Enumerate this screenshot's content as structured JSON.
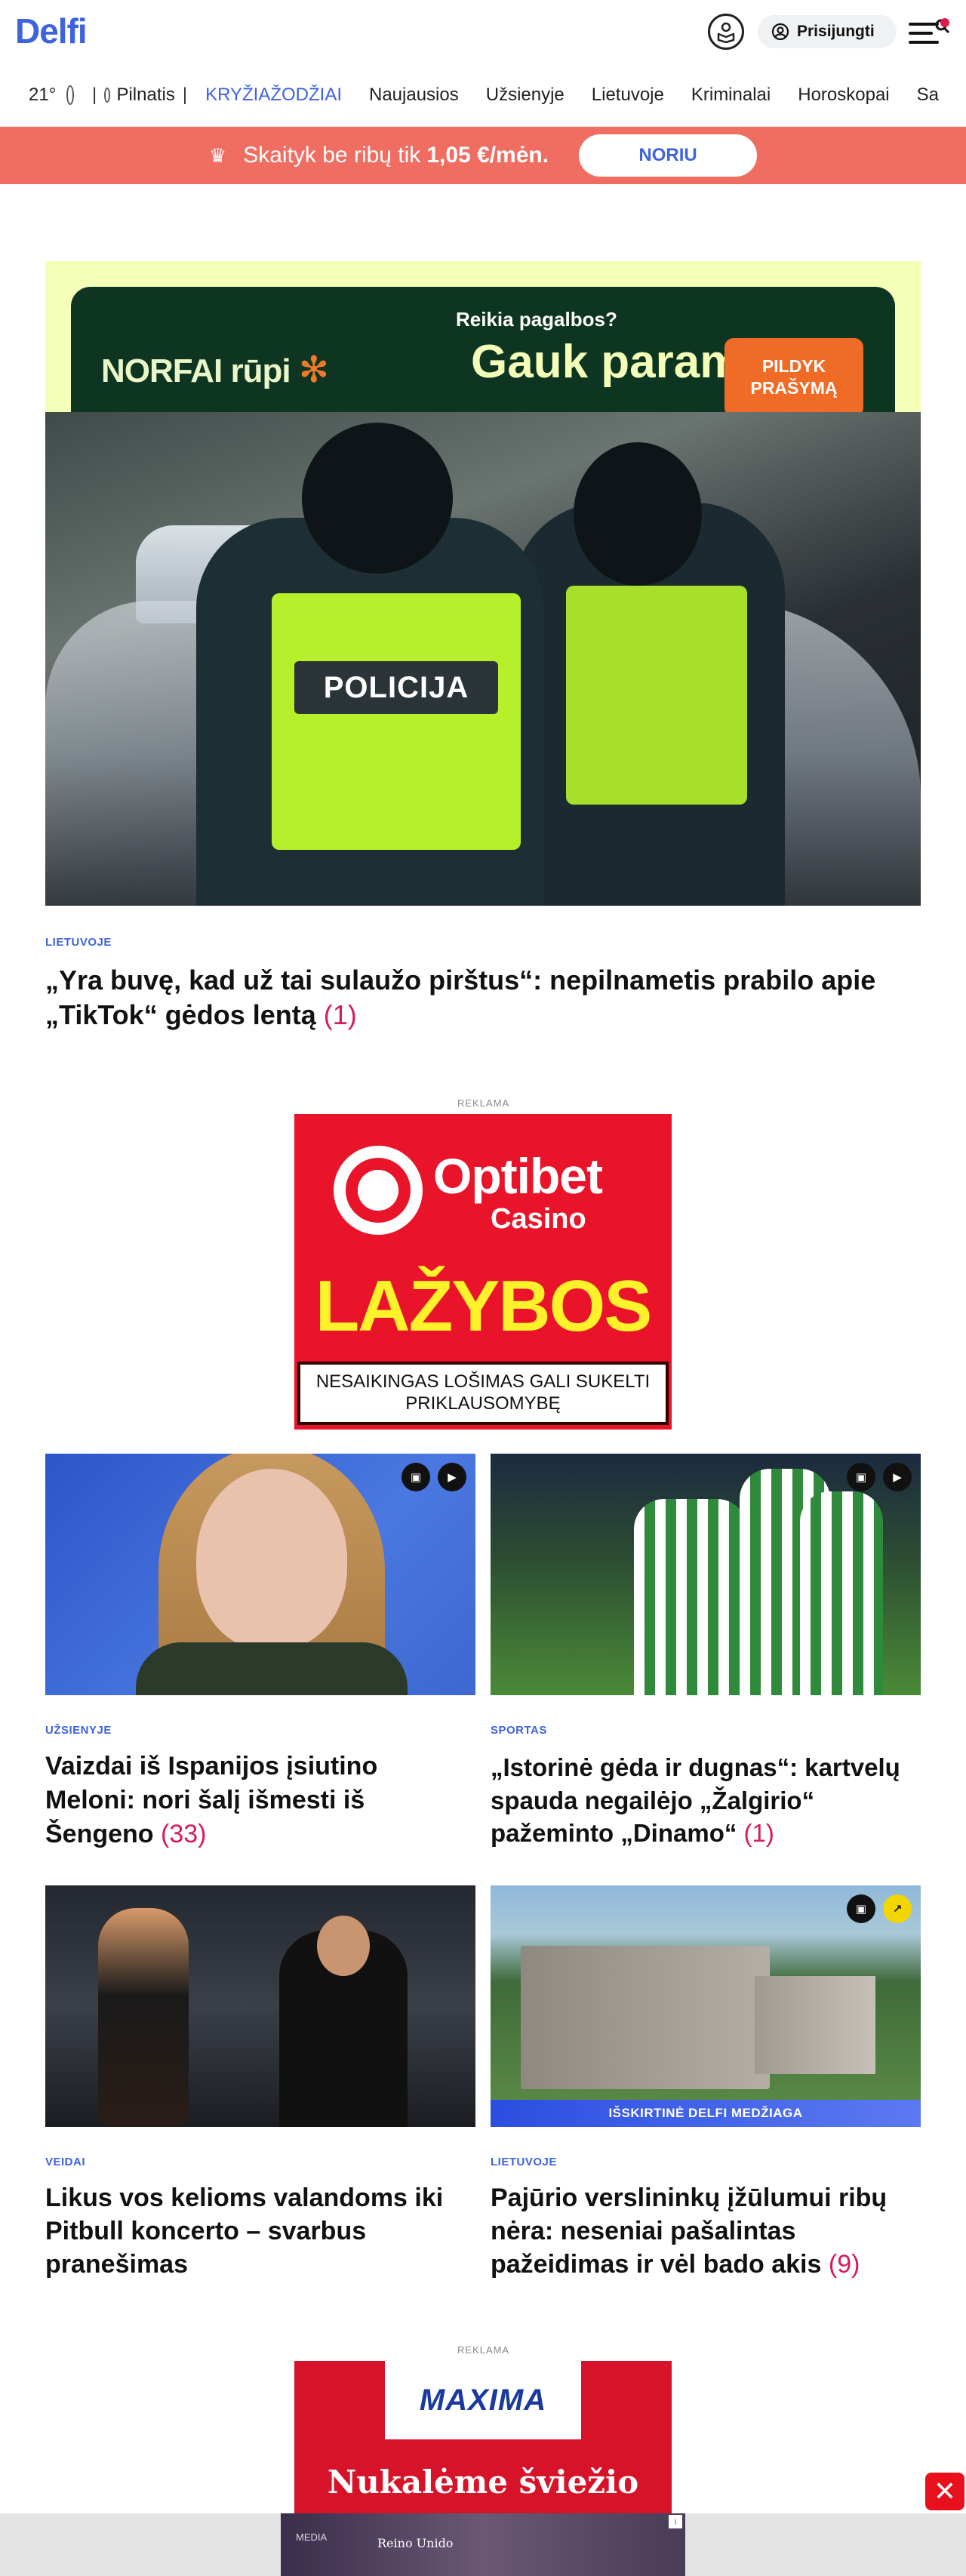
{
  "header": {
    "logo": "Delfi",
    "login_label": "Prisijungti"
  },
  "nav": {
    "temperature": "21°",
    "moon_label": "Pilnatis",
    "items": [
      "KRYŽIAŽODŽIAI",
      "Naujausios",
      "Užsienyje",
      "Lietuvoje",
      "Kriminalai",
      "Horoskopai",
      "Sa"
    ]
  },
  "promo": {
    "text": "Skaityk be ribų tik",
    "price": "1,05 €/mėn.",
    "button": "NORIU"
  },
  "norfai_ad": {
    "logo_text": "NORFAI rūpi",
    "question": "Reikia pagalbos?",
    "headline": "Gauk parama",
    "button": "PILDYK PRAŠYMĄ"
  },
  "hero": {
    "image_label": "POLICIJA",
    "category": "LIETUVOJE",
    "title": "„Yra buvę, kad už tai sulaužo pirštus“: nepilnametis prabilo apie „TikTok“ gėdos lentą",
    "comments": "(1)"
  },
  "ad_label": "REKLAMA",
  "optibet_ad": {
    "brand": "Optibet",
    "sub": "Casino",
    "big": "LAŽYBOS",
    "warning": "NESAIKINGAS LOŠIMAS GALI SUKELTI PRIKLAUSOMYBĘ"
  },
  "articles": [
    {
      "category": "UŽSIENYJE",
      "title": "Vaizdai iš Ispanijos įsiutino Meloni: nori šalį išmesti iš Šengeno",
      "comments": "(33)"
    },
    {
      "category": "SPORTAS",
      "title": "„Istorinė gėda ir dugnas“: kartvelų spauda negailėjo „Žalgirio“ pažeminto „Dinamo“",
      "comments": "(1)"
    },
    {
      "category": "VEIDAI",
      "title": "Likus vos kelioms valandoms iki Pitbull koncerto – svarbus pranešimas",
      "comments": ""
    },
    {
      "category": "LIETUVOJE",
      "title": "Pajūrio verslininkų įžūlumui ribų nėra: neseniai pašalintas pažeidimas ir vėl bado akis",
      "comments": "(9)",
      "image_strip": "IŠSKIRTINĖ DELFI MEDŽIAGA"
    }
  ],
  "maxima_ad": {
    "brand": "MAXIMA",
    "slogan": "Nukalėme šviežio"
  },
  "bottom_ad": {
    "small_text": "MEDIA",
    "text": "Reino Unido",
    "info": "i"
  },
  "close_label": "✕",
  "colors": {
    "brand": "#3d63dd",
    "promo": "#f06d62",
    "comments": "#d81b5c"
  }
}
